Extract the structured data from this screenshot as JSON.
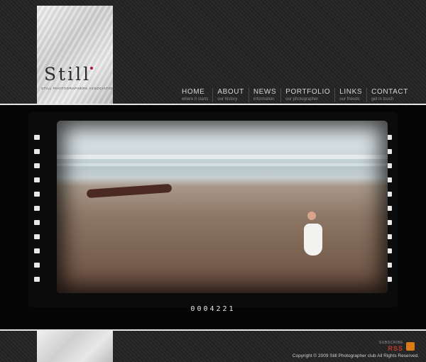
{
  "logo": {
    "word": "Still",
    "tagline": "STILL PHOTOGRAPHERS ASSOCIATION"
  },
  "nav": [
    {
      "label": "HOME",
      "sub": "where it starts"
    },
    {
      "label": "ABOUT",
      "sub": "our history"
    },
    {
      "label": "NEWS",
      "sub": "information"
    },
    {
      "label": "PORTFOLIO",
      "sub": "our photographer"
    },
    {
      "label": "LINKS",
      "sub": "our friends"
    },
    {
      "label": "CONTACT",
      "sub": "get in touch"
    }
  ],
  "gallery": {
    "counter": "0004221"
  },
  "footer": {
    "subscribe": "SUBSCRIBE",
    "rss": "RSS",
    "copyright": "Copyright © 2009 Still Photographer club  All Rights Reserved."
  },
  "colors": {
    "accent": "#b3122d",
    "rss": "#c0392b"
  }
}
